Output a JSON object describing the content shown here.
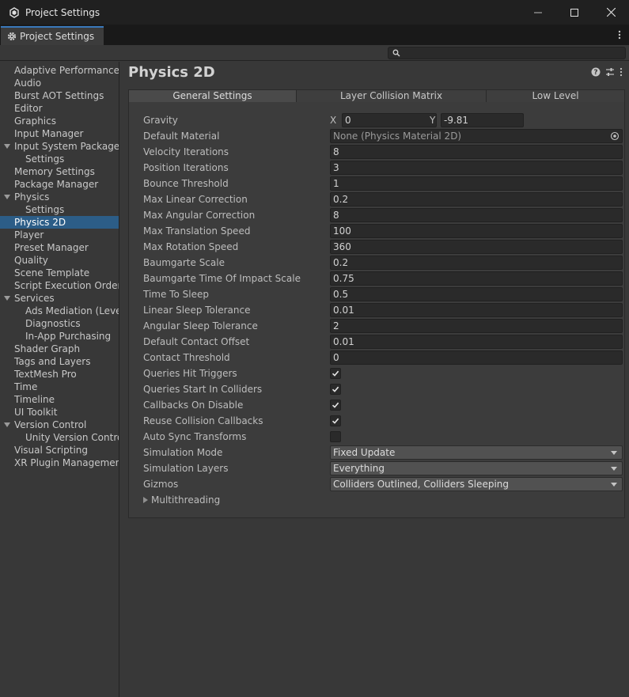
{
  "window": {
    "title": "Project Settings"
  },
  "tab": {
    "label": "Project Settings"
  },
  "sidebar": {
    "items": [
      {
        "label": "Adaptive Performance",
        "indent": 0
      },
      {
        "label": "Audio",
        "indent": 0
      },
      {
        "label": "Burst AOT Settings",
        "indent": 0
      },
      {
        "label": "Editor",
        "indent": 0
      },
      {
        "label": "Graphics",
        "indent": 0
      },
      {
        "label": "Input Manager",
        "indent": 0
      },
      {
        "label": "Input System Package",
        "indent": 0,
        "expanded": true
      },
      {
        "label": "Settings",
        "indent": 1
      },
      {
        "label": "Memory Settings",
        "indent": 0
      },
      {
        "label": "Package Manager",
        "indent": 0
      },
      {
        "label": "Physics",
        "indent": 0,
        "expanded": true
      },
      {
        "label": "Settings",
        "indent": 1
      },
      {
        "label": "Physics 2D",
        "indent": 0,
        "selected": true
      },
      {
        "label": "Player",
        "indent": 0
      },
      {
        "label": "Preset Manager",
        "indent": 0
      },
      {
        "label": "Quality",
        "indent": 0
      },
      {
        "label": "Scene Template",
        "indent": 0
      },
      {
        "label": "Script Execution Order",
        "indent": 0
      },
      {
        "label": "Services",
        "indent": 0,
        "expanded": true
      },
      {
        "label": "Ads Mediation (Level",
        "indent": 1
      },
      {
        "label": "Diagnostics",
        "indent": 1
      },
      {
        "label": "In-App Purchasing",
        "indent": 1
      },
      {
        "label": "Shader Graph",
        "indent": 0
      },
      {
        "label": "Tags and Layers",
        "indent": 0
      },
      {
        "label": "TextMesh Pro",
        "indent": 0
      },
      {
        "label": "Time",
        "indent": 0
      },
      {
        "label": "Timeline",
        "indent": 0
      },
      {
        "label": "UI Toolkit",
        "indent": 0
      },
      {
        "label": "Version Control",
        "indent": 0,
        "expanded": true
      },
      {
        "label": "Unity Version Control",
        "indent": 1
      },
      {
        "label": "Visual Scripting",
        "indent": 0
      },
      {
        "label": "XR Plugin Management",
        "indent": 0
      }
    ]
  },
  "main": {
    "title": "Physics 2D",
    "tabs": [
      {
        "label": "General Settings",
        "active": true
      },
      {
        "label": "Layer Collision Matrix",
        "active": false
      },
      {
        "label": "Low Level",
        "active": false
      }
    ],
    "gravity": {
      "label": "Gravity",
      "x_label": "X",
      "x": "0",
      "y_label": "Y",
      "y": "-9.81"
    },
    "default_material": {
      "label": "Default Material",
      "value": "None (Physics Material 2D)"
    },
    "fields": [
      {
        "label": "Velocity Iterations",
        "value": "8"
      },
      {
        "label": "Position Iterations",
        "value": "3"
      },
      {
        "label": "Bounce Threshold",
        "value": "1"
      },
      {
        "label": "Max Linear Correction",
        "value": "0.2"
      },
      {
        "label": "Max Angular Correction",
        "value": "8"
      },
      {
        "label": "Max Translation Speed",
        "value": "100"
      },
      {
        "label": "Max Rotation Speed",
        "value": "360"
      },
      {
        "label": "Baumgarte Scale",
        "value": "0.2"
      },
      {
        "label": "Baumgarte Time Of Impact Scale",
        "value": "0.75"
      },
      {
        "label": "Time To Sleep",
        "value": "0.5"
      },
      {
        "label": "Linear Sleep Tolerance",
        "value": "0.01"
      },
      {
        "label": "Angular Sleep Tolerance",
        "value": "2"
      },
      {
        "label": "Default Contact Offset",
        "value": "0.01"
      },
      {
        "label": "Contact Threshold",
        "value": "0"
      }
    ],
    "checkboxes": [
      {
        "label": "Queries Hit Triggers",
        "checked": true
      },
      {
        "label": "Queries Start In Colliders",
        "checked": true
      },
      {
        "label": "Callbacks On Disable",
        "checked": true
      },
      {
        "label": "Reuse Collision Callbacks",
        "checked": true
      },
      {
        "label": "Auto Sync Transforms",
        "checked": false
      }
    ],
    "dropdowns": [
      {
        "label": "Simulation Mode",
        "value": "Fixed Update"
      },
      {
        "label": "Simulation Layers",
        "value": "Everything"
      },
      {
        "label": "Gizmos",
        "value": "Colliders Outlined, Colliders Sleeping"
      }
    ],
    "foldout": {
      "label": "Multithreading"
    }
  },
  "colors": {
    "accent": "#3a79bb",
    "selection": "#2c5d87",
    "background": "#383838"
  }
}
